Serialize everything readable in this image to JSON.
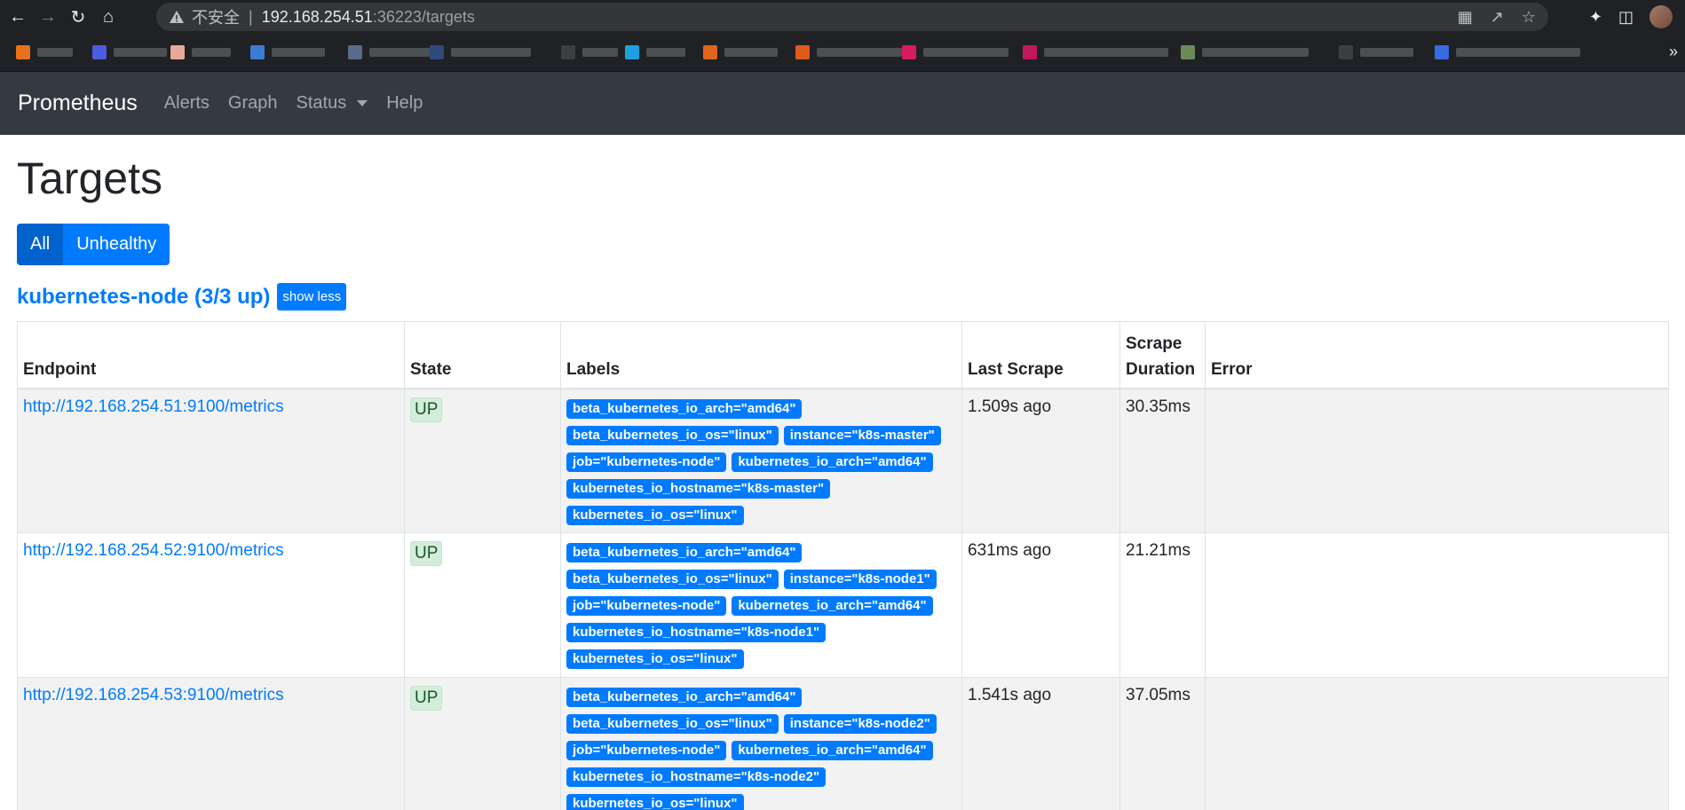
{
  "browser": {
    "insecure_label": "不安全",
    "separator": "|",
    "url_host": "192.168.254.51",
    "url_path": ":36223/targets",
    "more_label": "»"
  },
  "nav": {
    "brand": "Prometheus",
    "links": [
      "Alerts",
      "Graph",
      "Status",
      "Help"
    ]
  },
  "page": {
    "title": "Targets",
    "filters": [
      "All",
      "Unhealthy"
    ],
    "job": {
      "name": "kubernetes-node (3/3 up)",
      "toggle_label": "show less"
    },
    "columns": [
      "Endpoint",
      "State",
      "Labels",
      "Last Scrape",
      "Scrape Duration",
      "Error"
    ],
    "rows": [
      {
        "endpoint": "http://192.168.254.51:9100/metrics",
        "state": "UP",
        "labels": [
          "beta_kubernetes_io_arch=\"amd64\"",
          "beta_kubernetes_io_os=\"linux\"",
          "instance=\"k8s-master\"",
          "job=\"kubernetes-node\"",
          "kubernetes_io_arch=\"amd64\"",
          "kubernetes_io_hostname=\"k8s-master\"",
          "kubernetes_io_os=\"linux\""
        ],
        "last_scrape": "1.509s ago",
        "duration": "30.35ms",
        "error": ""
      },
      {
        "endpoint": "http://192.168.254.52:9100/metrics",
        "state": "UP",
        "labels": [
          "beta_kubernetes_io_arch=\"amd64\"",
          "beta_kubernetes_io_os=\"linux\"",
          "instance=\"k8s-node1\"",
          "job=\"kubernetes-node\"",
          "kubernetes_io_arch=\"amd64\"",
          "kubernetes_io_hostname=\"k8s-node1\"",
          "kubernetes_io_os=\"linux\""
        ],
        "last_scrape": "631ms ago",
        "duration": "21.21ms",
        "error": ""
      },
      {
        "endpoint": "http://192.168.254.53:9100/metrics",
        "state": "UP",
        "labels": [
          "beta_kubernetes_io_arch=\"amd64\"",
          "beta_kubernetes_io_os=\"linux\"",
          "instance=\"k8s-node2\"",
          "job=\"kubernetes-node\"",
          "kubernetes_io_arch=\"amd64\"",
          "kubernetes_io_hostname=\"k8s-node2\"",
          "kubernetes_io_os=\"linux\""
        ],
        "last_scrape": "1.541s ago",
        "duration": "37.05ms",
        "error": ""
      }
    ]
  },
  "colors": {
    "primary": "#007bff",
    "navbar": "#343a40",
    "up_bg": "#d4edda",
    "up_text": "#155724"
  }
}
